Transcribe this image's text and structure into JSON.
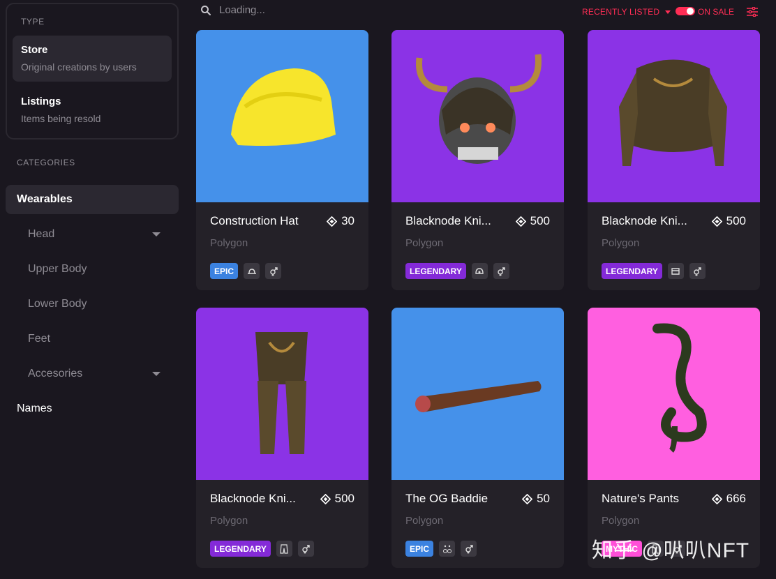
{
  "sidebar": {
    "type_title": "TYPE",
    "type_options": [
      {
        "label": "Store",
        "sub": "Original creations by users"
      },
      {
        "label": "Listings",
        "sub": "Items being resold"
      }
    ],
    "categories_title": "CATEGORIES",
    "categories": [
      {
        "label": "Wearables"
      },
      {
        "label": "Head"
      },
      {
        "label": "Upper Body"
      },
      {
        "label": "Lower Body"
      },
      {
        "label": "Feet"
      },
      {
        "label": "Accesories"
      },
      {
        "label": "Names"
      }
    ]
  },
  "topbar": {
    "search_placeholder": "Loading...",
    "sort_label": "RECENTLY LISTED",
    "on_sale_label": "ON SALE",
    "accent": "#ff2d55"
  },
  "cards": [
    {
      "name": "Construction Hat",
      "price": "30",
      "network": "Polygon",
      "rarity": "EPIC",
      "rarity_color": "#3b82e0",
      "bg": "#4591ea",
      "icon": "hat-icon"
    },
    {
      "name": "Blacknode Kni...",
      "price": "500",
      "network": "Polygon",
      "rarity": "LEGENDARY",
      "rarity_color": "#842ad8",
      "bg": "#8b33e6",
      "icon": "helmet-icon"
    },
    {
      "name": "Blacknode Kni...",
      "price": "500",
      "network": "Polygon",
      "rarity": "LEGENDARY",
      "rarity_color": "#842ad8",
      "bg": "#8b33e6",
      "icon": "upper-body-icon"
    },
    {
      "name": "Blacknode Kni...",
      "price": "500",
      "network": "Polygon",
      "rarity": "LEGENDARY",
      "rarity_color": "#842ad8",
      "bg": "#8b33e6",
      "icon": "lower-body-icon"
    },
    {
      "name": "The OG Baddie",
      "price": "50",
      "network": "Polygon",
      "rarity": "EPIC",
      "rarity_color": "#3b82e0",
      "bg": "#4591ea",
      "icon": "earring-icon"
    },
    {
      "name": "Nature's Pants",
      "price": "666",
      "network": "Polygon",
      "rarity": "MYTHIC",
      "rarity_color": "#ff4fd8",
      "bg": "#ff5fe0",
      "icon": "lower-body-icon"
    }
  ],
  "watermark": "知乎 @叭叭NFT"
}
